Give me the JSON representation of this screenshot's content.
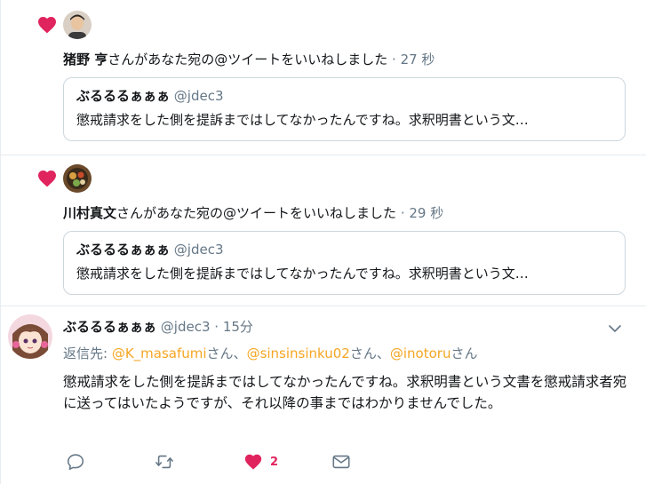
{
  "notifications": [
    {
      "user": "猪野 亨",
      "action": "さんがあなた宛の@ツイートをいいねしました",
      "time": "· 27 秒",
      "quote": {
        "name": "ぶるるるぁぁぁ",
        "handle": "@jdec3",
        "text": "懲戒請求をした側を提訴まではしてなかったんですね。求釈明書という文…"
      }
    },
    {
      "user": "川村真文",
      "action": "さんがあなた宛の@ツイートをいいねしました",
      "time": "· 29 秒",
      "quote": {
        "name": "ぶるるるぁぁぁ",
        "handle": "@jdec3",
        "text": "懲戒請求をした側を提訴まではしてなかったんですね。求釈明書という文…"
      }
    }
  ],
  "tweet": {
    "name": "ぶるるるぁぁぁ",
    "handle": "@jdec3",
    "time": "· 15分",
    "reply_prefix": "返信先: ",
    "mention1": "@K_masafumi",
    "sep1": "さん、",
    "mention2": "@sinsinsinku02",
    "sep2": "さん、",
    "mention3": "@inotoru",
    "sep3": "さん",
    "text": "懲戒請求をした側を提訴まではしてなかったんですね。求釈明書という文書を懲戒請求者宛に送ってはいたようですが、それ以降の事まではわかりませんでした。",
    "like_count": "2"
  },
  "colors": {
    "heart": "#e0245e",
    "mention": "#f5a623",
    "muted": "#657786",
    "border": "#ccd6dd"
  },
  "icons": [
    "heart-icon",
    "caret-down-icon",
    "reply-icon",
    "retweet-icon",
    "like-icon",
    "message-icon"
  ]
}
